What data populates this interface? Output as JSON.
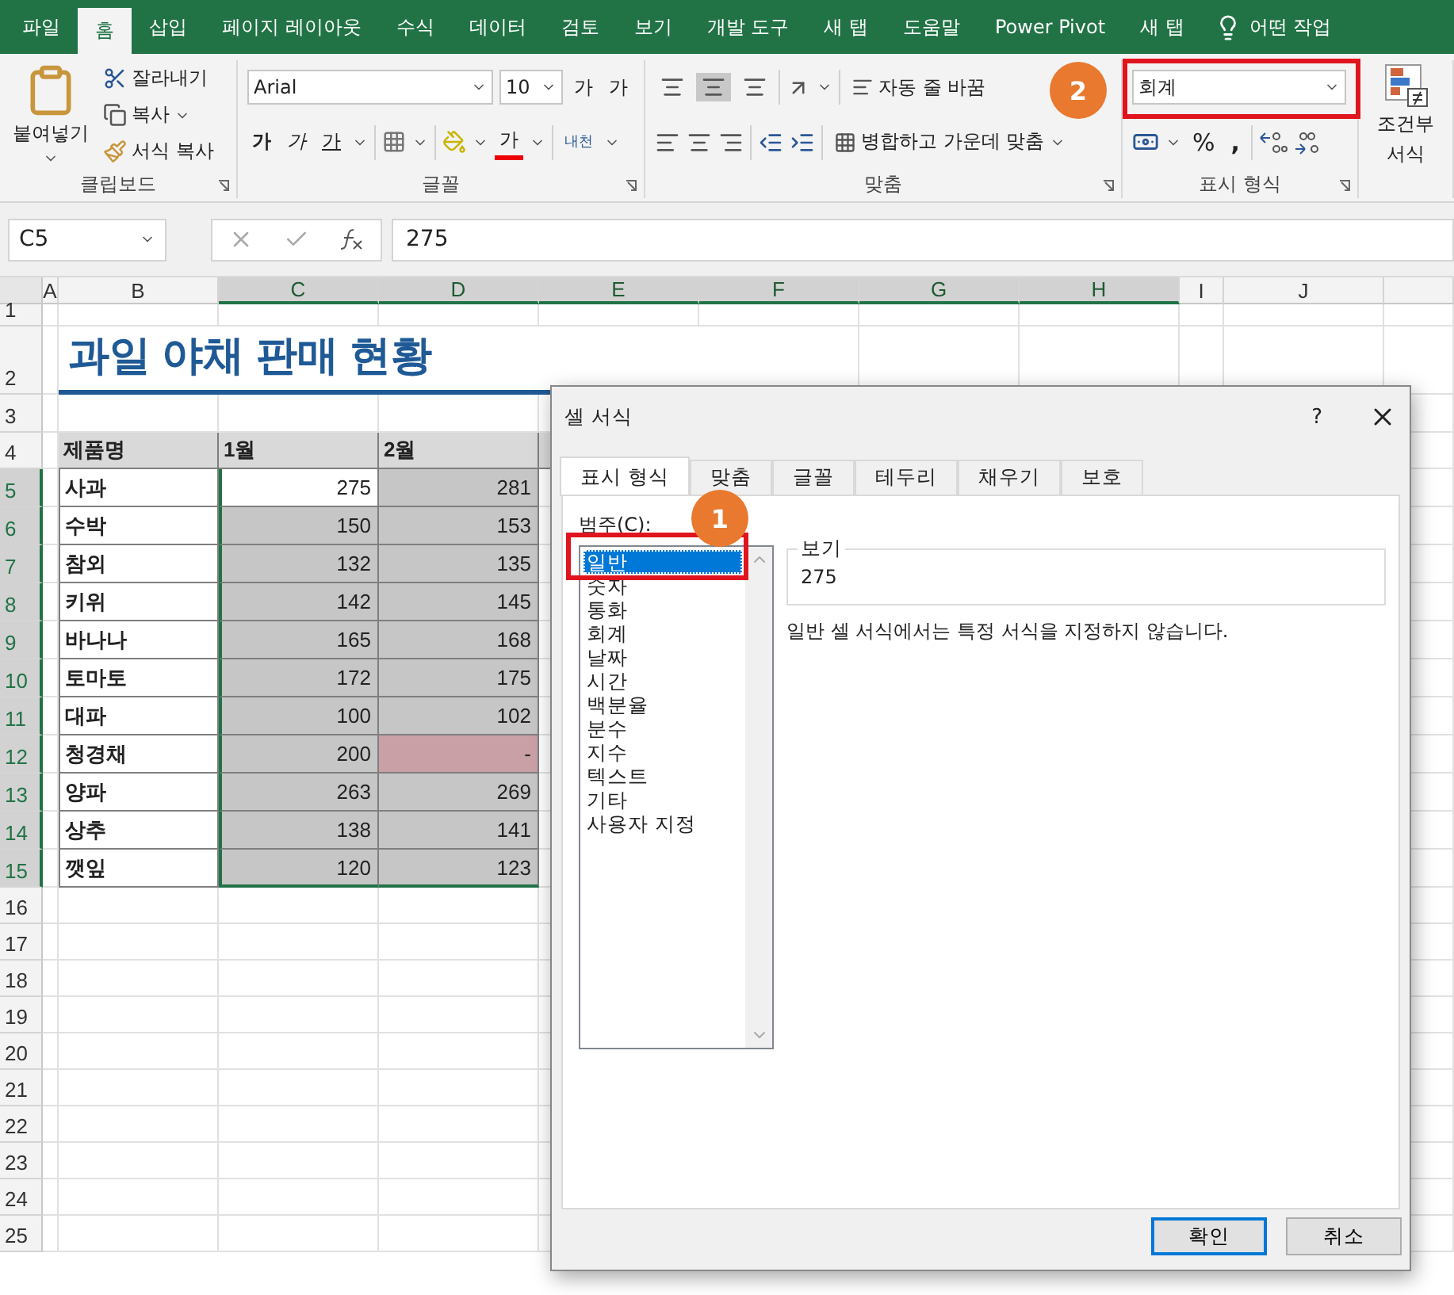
{
  "menu_tabs": [
    {
      "label": "파일",
      "selected": false
    },
    {
      "label": "홈",
      "selected": true
    },
    {
      "label": "삽입",
      "selected": false
    },
    {
      "label": "페이지 레이아웃",
      "selected": false
    },
    {
      "label": "수식",
      "selected": false
    },
    {
      "label": "데이터",
      "selected": false
    },
    {
      "label": "검토",
      "selected": false
    },
    {
      "label": "보기",
      "selected": false
    },
    {
      "label": "개발 도구",
      "selected": false
    },
    {
      "label": "새 탭",
      "selected": false
    },
    {
      "label": "도움말",
      "selected": false
    },
    {
      "label": "Power Pivot",
      "selected": false
    },
    {
      "label": "새 탭",
      "selected": false
    }
  ],
  "tell_me": "어떤 작업",
  "clipboard": {
    "paste": "붙여넣기",
    "cut": "잘라내기",
    "copy": "복사",
    "format_painter": "서식 복사",
    "group": "클립보드"
  },
  "font": {
    "name": "Arial",
    "size": "10",
    "grow": "가",
    "shrink": "가",
    "bold": "가",
    "italic": "가",
    "underline": "가",
    "font_color": "가",
    "phonetic": "내천",
    "group": "글꼴"
  },
  "alignment": {
    "vertical": [
      {
        "selected": false
      },
      {
        "selected": true
      },
      {
        "selected": false
      }
    ],
    "wrap": "자동 줄 바꿈",
    "merge": "병합하고 가운데 맞춤",
    "group": "맞춤"
  },
  "number": {
    "format": "회계",
    "percent": "%",
    "comma": ",",
    "group": "표시 형식"
  },
  "styles": {
    "conditional_top": "조건부",
    "conditional_bottom": "서식"
  },
  "formula_bar": {
    "name_box": "C5",
    "value": "275"
  },
  "sheet": {
    "columns": [
      {
        "label": "A",
        "selected": false
      },
      {
        "label": "B",
        "selected": false
      },
      {
        "label": "C",
        "selected": true
      },
      {
        "label": "D",
        "selected": true
      },
      {
        "label": "E",
        "selected": true
      },
      {
        "label": "F",
        "selected": true
      },
      {
        "label": "G",
        "selected": true
      },
      {
        "label": "H",
        "selected": true
      },
      {
        "label": "I",
        "selected": false
      },
      {
        "label": "J",
        "selected": false
      }
    ],
    "rows": [
      {
        "label": "1",
        "selected": false
      },
      {
        "label": "2",
        "selected": false
      },
      {
        "label": "3",
        "selected": false
      },
      {
        "label": "4",
        "selected": false
      },
      {
        "label": "5",
        "selected": true
      },
      {
        "label": "6",
        "selected": true
      },
      {
        "label": "7",
        "selected": true
      },
      {
        "label": "8",
        "selected": true
      },
      {
        "label": "9",
        "selected": true
      },
      {
        "label": "10",
        "selected": true
      },
      {
        "label": "11",
        "selected": true
      },
      {
        "label": "12",
        "selected": true
      },
      {
        "label": "13",
        "selected": true
      },
      {
        "label": "14",
        "selected": true
      },
      {
        "label": "15",
        "selected": true
      },
      {
        "label": "16",
        "selected": false
      },
      {
        "label": "17",
        "selected": false
      },
      {
        "label": "18",
        "selected": false
      },
      {
        "label": "19",
        "selected": false
      },
      {
        "label": "20",
        "selected": false
      },
      {
        "label": "21",
        "selected": false
      },
      {
        "label": "22",
        "selected": false
      },
      {
        "label": "23",
        "selected": false
      },
      {
        "label": "24",
        "selected": false
      },
      {
        "label": "25",
        "selected": false
      }
    ],
    "title": "과일 야채 판매 현황",
    "header": [
      "제품명",
      "1월",
      "2월"
    ],
    "data": [
      {
        "name": "사과",
        "values": [
          {
            "text": "275",
            "active": true,
            "flagged": false
          },
          {
            "text": "281",
            "active": false,
            "flagged": false
          }
        ]
      },
      {
        "name": "수박",
        "values": [
          {
            "text": "150",
            "active": false,
            "flagged": false
          },
          {
            "text": "153",
            "active": false,
            "flagged": false
          }
        ]
      },
      {
        "name": "참외",
        "values": [
          {
            "text": "132",
            "active": false,
            "flagged": false
          },
          {
            "text": "135",
            "active": false,
            "flagged": false
          }
        ]
      },
      {
        "name": "키위",
        "values": [
          {
            "text": "142",
            "active": false,
            "flagged": false
          },
          {
            "text": "145",
            "active": false,
            "flagged": false
          }
        ]
      },
      {
        "name": "바나나",
        "values": [
          {
            "text": "165",
            "active": false,
            "flagged": false
          },
          {
            "text": "168",
            "active": false,
            "flagged": false
          }
        ]
      },
      {
        "name": "토마토",
        "values": [
          {
            "text": "172",
            "active": false,
            "flagged": false
          },
          {
            "text": "175",
            "active": false,
            "flagged": false
          }
        ]
      },
      {
        "name": "대파",
        "values": [
          {
            "text": "100",
            "active": false,
            "flagged": false
          },
          {
            "text": "102",
            "active": false,
            "flagged": false
          }
        ]
      },
      {
        "name": "청경채",
        "values": [
          {
            "text": "200",
            "active": false,
            "flagged": false
          },
          {
            "text": "-",
            "active": false,
            "flagged": true
          }
        ]
      },
      {
        "name": "양파",
        "values": [
          {
            "text": "263",
            "active": false,
            "flagged": false
          },
          {
            "text": "269",
            "active": false,
            "flagged": false
          }
        ]
      },
      {
        "name": "상추",
        "values": [
          {
            "text": "138",
            "active": false,
            "flagged": false
          },
          {
            "text": "141",
            "active": false,
            "flagged": false
          }
        ]
      },
      {
        "name": "깻잎",
        "values": [
          {
            "text": "120",
            "active": false,
            "flagged": false
          },
          {
            "text": "123",
            "active": false,
            "flagged": false
          }
        ]
      }
    ]
  },
  "dialog": {
    "title": "셀 서식",
    "help": "?",
    "tabs": [
      {
        "label": "표시 형식",
        "selected": true
      },
      {
        "label": "맞춤",
        "selected": false
      },
      {
        "label": "글꼴",
        "selected": false
      },
      {
        "label": "테두리",
        "selected": false
      },
      {
        "label": "채우기",
        "selected": false
      },
      {
        "label": "보호",
        "selected": false
      }
    ],
    "category_label": "범주(C):",
    "categories": [
      {
        "label": "일반",
        "selected": true
      },
      {
        "label": "숫자",
        "selected": false
      },
      {
        "label": "통화",
        "selected": false
      },
      {
        "label": "회계",
        "selected": false
      },
      {
        "label": "날짜",
        "selected": false
      },
      {
        "label": "시간",
        "selected": false
      },
      {
        "label": "백분율",
        "selected": false
      },
      {
        "label": "분수",
        "selected": false
      },
      {
        "label": "지수",
        "selected": false
      },
      {
        "label": "텍스트",
        "selected": false
      },
      {
        "label": "기타",
        "selected": false
      },
      {
        "label": "사용자 지정",
        "selected": false
      }
    ],
    "preview_label": "보기",
    "preview_value": "275",
    "description": "일반 셀 서식에서는 특정 서식을 지정하지 않습니다.",
    "buttons": [
      {
        "label": "확인",
        "default": true
      },
      {
        "label": "취소",
        "default": false
      }
    ]
  },
  "callouts": [
    {
      "number": "1",
      "kind": "category"
    },
    {
      "number": "2",
      "kind": "number_format"
    }
  ]
}
